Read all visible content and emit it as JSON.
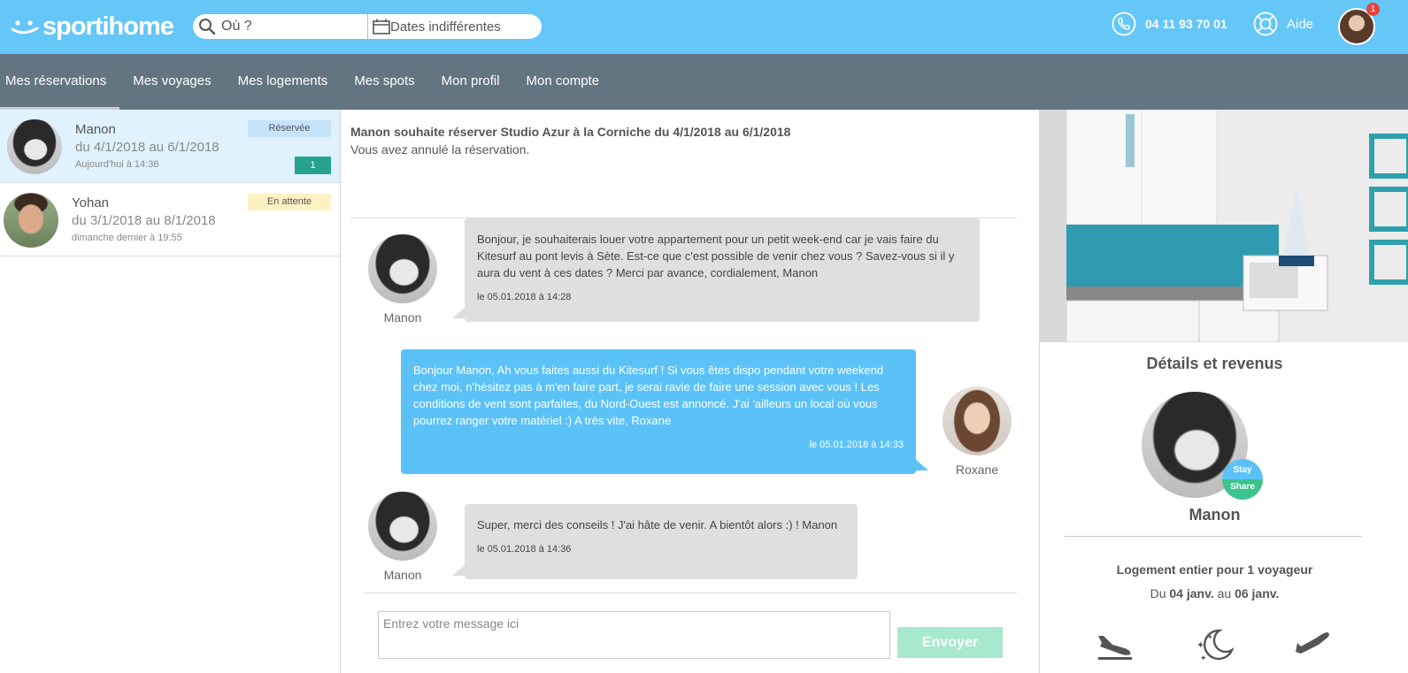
{
  "header": {
    "logo": "sportihome",
    "search_placeholder": "Où ?",
    "dates_label": "Dates indifférentes",
    "phone": "04 11 93 70 01",
    "help": "Aide",
    "notification_count": "1"
  },
  "nav": {
    "items": [
      "Mes réservations",
      "Mes voyages",
      "Mes logements",
      "Mes spots",
      "Mon profil",
      "Mon compte"
    ],
    "active": "Mes réservations"
  },
  "reservations": [
    {
      "name": "Manon",
      "dates": "du 4/1/2018 au 6/1/2018",
      "time": "Aujourd'hui à 14:36",
      "status": "Réservée",
      "count": "1"
    },
    {
      "name": "Yohan",
      "dates": "du 3/1/2018 au 8/1/2018",
      "time": "dimanche dernier à 19:55",
      "status": "En attente"
    }
  ],
  "conversation": {
    "title": "Manon souhaite réserver Studio Azur à la Corniche du 4/1/2018 au 6/1/2018",
    "subtitle": "Vous avez annulé la réservation.",
    "messages": [
      {
        "author": "Manon",
        "text": "Bonjour, je souhaiterais louer votre appartement pour un petit week-end car je vais faire du Kitesurf au pont levis à Sète. Est-ce que c'est possible de venir chez vous ? Savez-vous si il y aura du vent à ces dates ? Merci par avance, cordialement, Manon",
        "time": "le 05.01.2018 à 14:28"
      },
      {
        "author": "Roxane",
        "text": "Bonjour Manon, Ah vous faites aussi du Kitesurf ! Si vous êtes dispo pendant votre weekend chez moi, n'hésitez pas à m'en faire part, je serai ravie de faire une session avec vous ! Les conditions de vent sont parfaites, du Nord-Ouest est annoncé. J'ai 'ailleurs un local où vous pourrez ranger votre matériel :) A très vite, Roxane",
        "time": "le 05.01.2018 à 14:33"
      },
      {
        "author": "Manon",
        "text": "Super, merci des conseils ! J'ai hâte de venir. A bientôt alors :) ! Manon",
        "time": "le 05.01.2018 à 14:36"
      }
    ],
    "input_placeholder": "Entrez votre message ici",
    "send_label": "Envoyer"
  },
  "details": {
    "title": "Détails et revenus",
    "host_name": "Manon",
    "badge_top": "Stay",
    "badge_bottom": "Share",
    "stay_type": "Logement entier pour 1 voyageur",
    "dates_prefix": "Du",
    "date_from": "04 janv.",
    "dates_mid": "au",
    "date_to": "06 janv."
  },
  "colors": {
    "header_bg": "#65c6f8",
    "nav_bg": "#647582",
    "selected_row": "#dff2fd",
    "outgoing_bubble": "#5bc2f8",
    "incoming_bubble": "#dfdfdf",
    "count_badge": "#27a38f",
    "send_button": "#a7e8cf"
  }
}
